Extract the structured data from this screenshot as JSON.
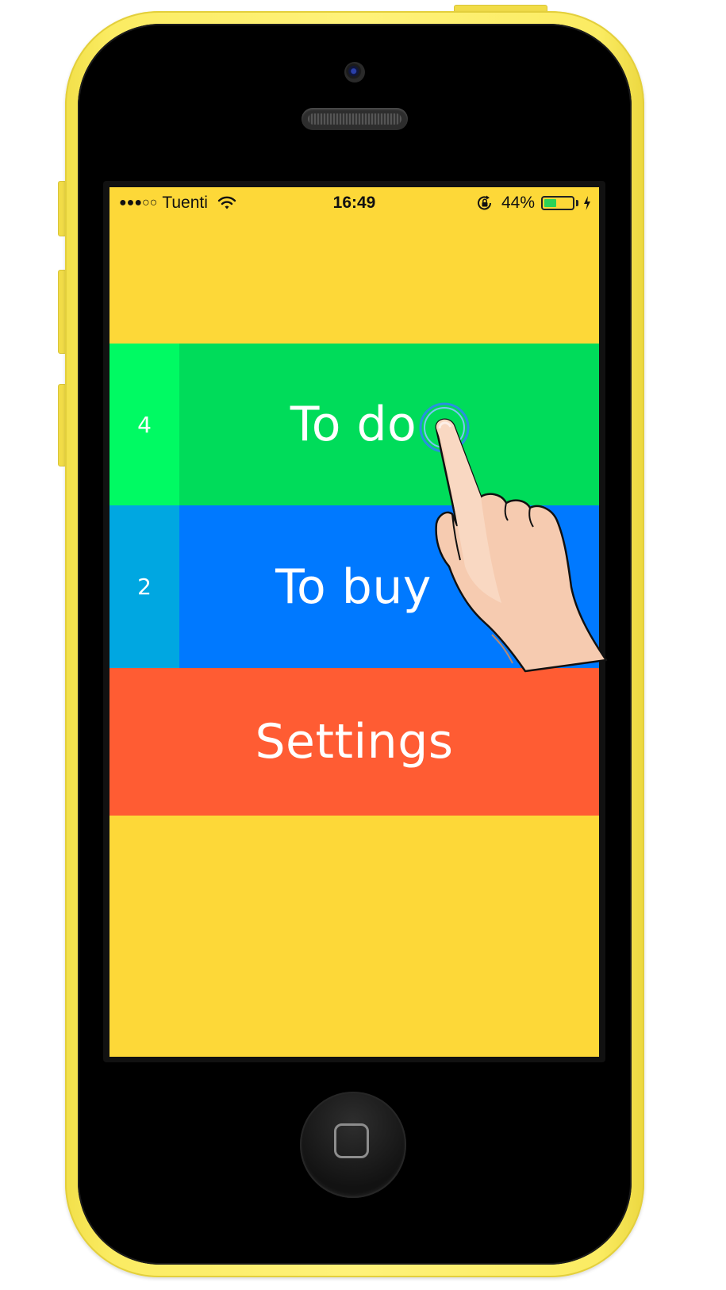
{
  "status_bar": {
    "signal": "●●●○○",
    "carrier": "Tuenti",
    "time": "16:49",
    "battery_percent": "44%",
    "battery_level": 0.44,
    "icons": [
      "wifi-icon",
      "rotation-lock-icon",
      "battery-icon",
      "charging-bolt-icon"
    ]
  },
  "menu": {
    "items": [
      {
        "label": "To do",
        "count": "4",
        "color": "#00dc5a",
        "count_color": "#00fa63"
      },
      {
        "label": "To buy",
        "count": "2",
        "color": "#0079ff",
        "count_color": "#00a7e1"
      },
      {
        "label": "Settings",
        "color": "#ff5c33"
      }
    ]
  },
  "colors": {
    "background": "#fdd838",
    "phone_body": "#fbec63"
  },
  "overlay": {
    "icon": "pointing-hand-icon",
    "touch_indicator": "tap-ring-icon"
  }
}
